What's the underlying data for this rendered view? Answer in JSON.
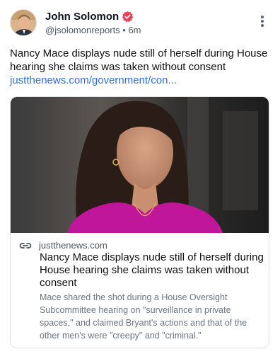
{
  "post": {
    "author_name": "John Solomon",
    "handle_time": "@jsolomonreports • 6m",
    "text": "Nancy Mace displays nude still of herself during House hearing she claims was taken without consent",
    "link_text": "justthenews.com/government/con..."
  },
  "card": {
    "domain": "justthenews.com",
    "title": "Nancy Mace displays nude still of herself during House hearing she claims was taken without consent",
    "description": "Mace shared the shot during a House Oversight Subcommittee hearing on \"surveillance in private spaces,\" and claimed Bryant's actions and that of the other men's were \"creepy\" and \"criminal.\""
  },
  "icons": {
    "verified": "verified-badge-icon",
    "more": "more-vertical-icon",
    "link": "link-icon"
  },
  "colors": {
    "link": "#2f6fdc",
    "verified": "#e8405b",
    "muted_text": "#6b7480",
    "card_border": "#dfe3e8",
    "dress": "#c0169a"
  }
}
